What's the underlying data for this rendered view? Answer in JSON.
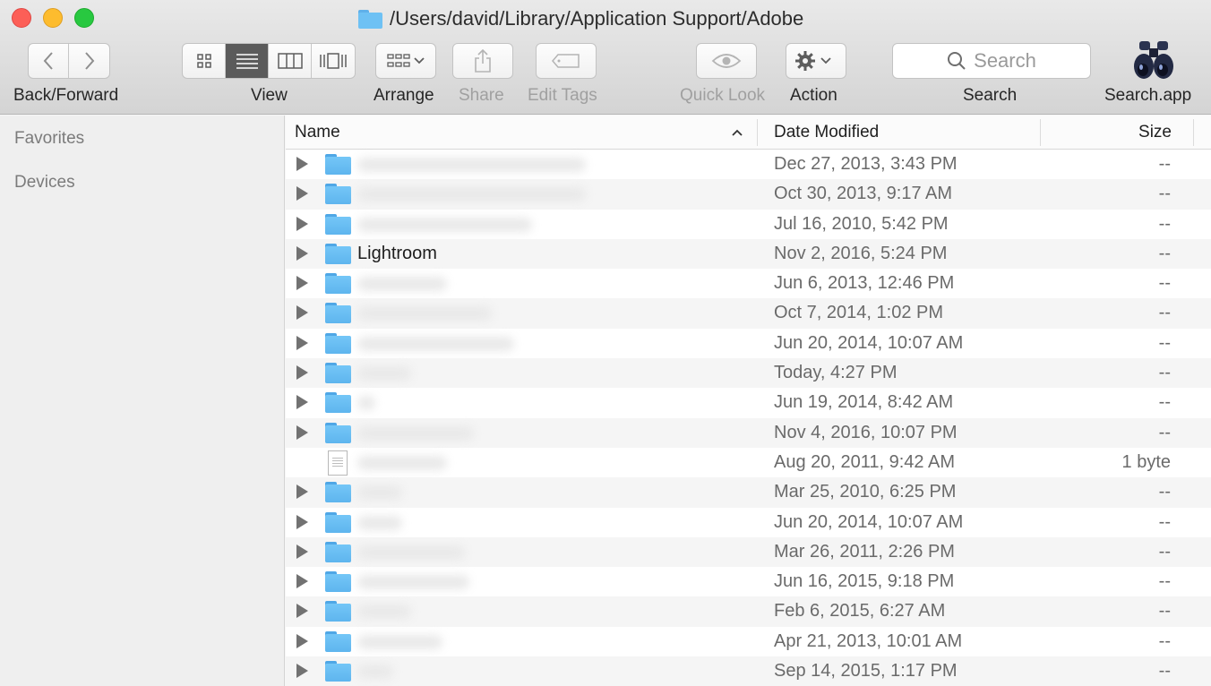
{
  "window": {
    "title": "/Users/david/Library/Application Support/Adobe"
  },
  "toolbar": {
    "back_label": "Back/Forward",
    "view_label": "View",
    "arrange_label": "Arrange",
    "share_label": "Share",
    "edit_tags_label": "Edit Tags",
    "quick_look_label": "Quick Look",
    "action_label": "Action",
    "search_label": "Search",
    "search_placeholder": "Search",
    "search_app_label": "Search.app"
  },
  "sidebar": {
    "favorites": "Favorites",
    "devices": "Devices"
  },
  "columns": {
    "name": "Name",
    "date": "Date Modified",
    "size": "Size"
  },
  "rows": [
    {
      "type": "folder",
      "name": "",
      "date": "Dec 27, 2013, 3:43 PM",
      "size": "--"
    },
    {
      "type": "folder",
      "name": "",
      "date": "Oct 30, 2013, 9:17 AM",
      "size": "--"
    },
    {
      "type": "folder",
      "name": "",
      "date": "Jul 16, 2010, 5:42 PM",
      "size": "--"
    },
    {
      "type": "folder",
      "name": "Lightroom",
      "date": "Nov 2, 2016, 5:24 PM",
      "size": "--"
    },
    {
      "type": "folder",
      "name": "",
      "date": "Jun 6, 2013, 12:46 PM",
      "size": "--"
    },
    {
      "type": "folder",
      "name": "",
      "date": "Oct 7, 2014, 1:02 PM",
      "size": "--"
    },
    {
      "type": "folder",
      "name": "",
      "date": "Jun 20, 2014, 10:07 AM",
      "size": "--"
    },
    {
      "type": "folder",
      "name": "",
      "date": "Today, 4:27 PM",
      "size": "--"
    },
    {
      "type": "folder",
      "name": "",
      "date": "Jun 19, 2014, 8:42 AM",
      "size": "--"
    },
    {
      "type": "folder",
      "name": "",
      "date": "Nov 4, 2016, 10:07 PM",
      "size": "--"
    },
    {
      "type": "file",
      "name": "",
      "date": "Aug 20, 2011, 9:42 AM",
      "size": "1 byte"
    },
    {
      "type": "folder",
      "name": "",
      "date": "Mar 25, 2010, 6:25 PM",
      "size": "--"
    },
    {
      "type": "folder",
      "name": "",
      "date": "Jun 20, 2014, 10:07 AM",
      "size": "--"
    },
    {
      "type": "folder",
      "name": "",
      "date": "Mar 26, 2011, 2:26 PM",
      "size": "--"
    },
    {
      "type": "folder",
      "name": "",
      "date": "Jun 16, 2015, 9:18 PM",
      "size": "--"
    },
    {
      "type": "folder",
      "name": "",
      "date": "Feb 6, 2015, 6:27 AM",
      "size": "--"
    },
    {
      "type": "folder",
      "name": "",
      "date": "Apr 21, 2013, 10:01 AM",
      "size": "--"
    },
    {
      "type": "folder",
      "name": "",
      "date": "Sep 14, 2015, 1:17 PM",
      "size": "--"
    }
  ]
}
